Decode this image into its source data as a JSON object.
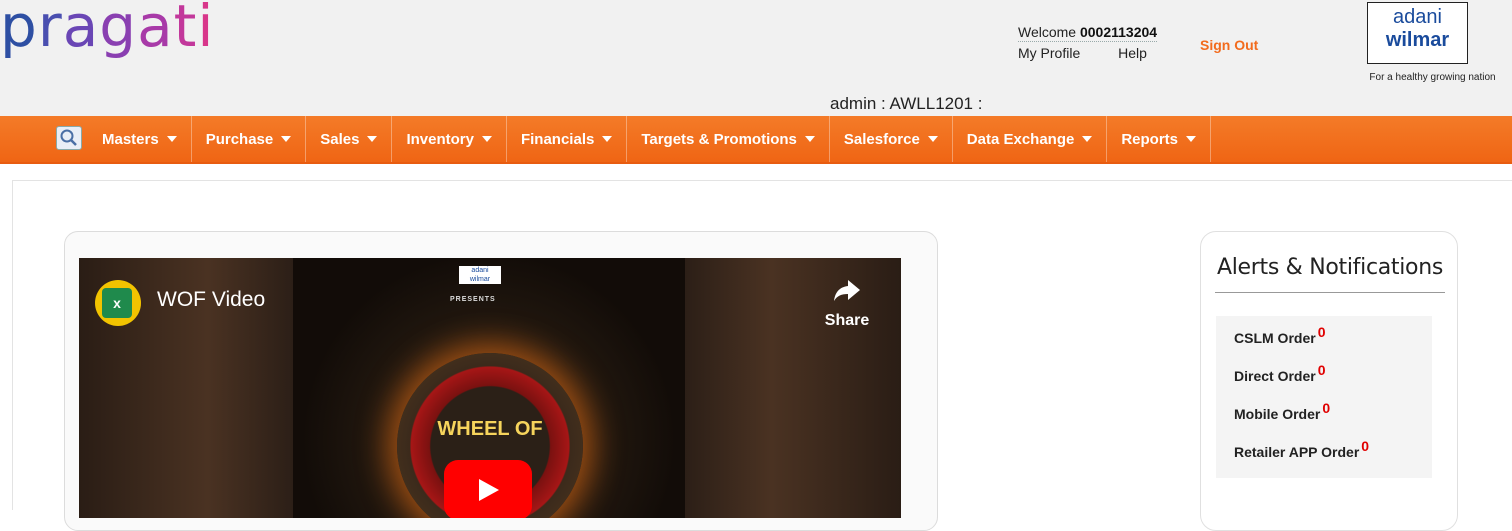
{
  "header": {
    "logo_letters": [
      {
        "char": "p",
        "color": "#2e4fa3"
      },
      {
        "char": "r",
        "color": "#4a4fb0"
      },
      {
        "char": "a",
        "color": "#6a46b5"
      },
      {
        "char": "g",
        "color": "#8a3fb1"
      },
      {
        "char": "a",
        "color": "#a83aa8"
      },
      {
        "char": "t",
        "color": "#c2389b"
      },
      {
        "char": "i",
        "color": "#d8368a"
      }
    ],
    "welcome_prefix": "Welcome",
    "user_id": "0002113204",
    "my_profile": "My Profile",
    "help": "Help",
    "sign_out": "Sign Out",
    "brand_top": "adani",
    "brand_bottom": "wilmar",
    "brand_tagline": "For a healthy growing nation",
    "admin_line": "admin : AWLL1201 :"
  },
  "nav": {
    "items": [
      "Masters",
      "Purchase",
      "Sales",
      "Inventory",
      "Financials",
      "Targets & Promotions",
      "Salesforce",
      "Data Exchange",
      "Reports"
    ]
  },
  "video": {
    "channel_letter": "x",
    "title": "WOF Video",
    "share_label": "Share",
    "brand_mini_top": "adani",
    "brand_mini_bottom": "wilmar",
    "presents": "PRESENTS",
    "wheel_text": "WHEEL OF"
  },
  "alerts": {
    "title": "Alerts & Notifications",
    "items": [
      {
        "label": "CSLM Order",
        "count": "0"
      },
      {
        "label": "Direct Order",
        "count": "0"
      },
      {
        "label": "Mobile Order",
        "count": "0"
      },
      {
        "label": "Retailer APP Order",
        "count": "0"
      }
    ]
  },
  "colors": {
    "nav_orange": "#f26b1d",
    "sign_out": "#f26b1d",
    "alert_count": "#e00000",
    "brand_blue": "#1a4b9c"
  }
}
